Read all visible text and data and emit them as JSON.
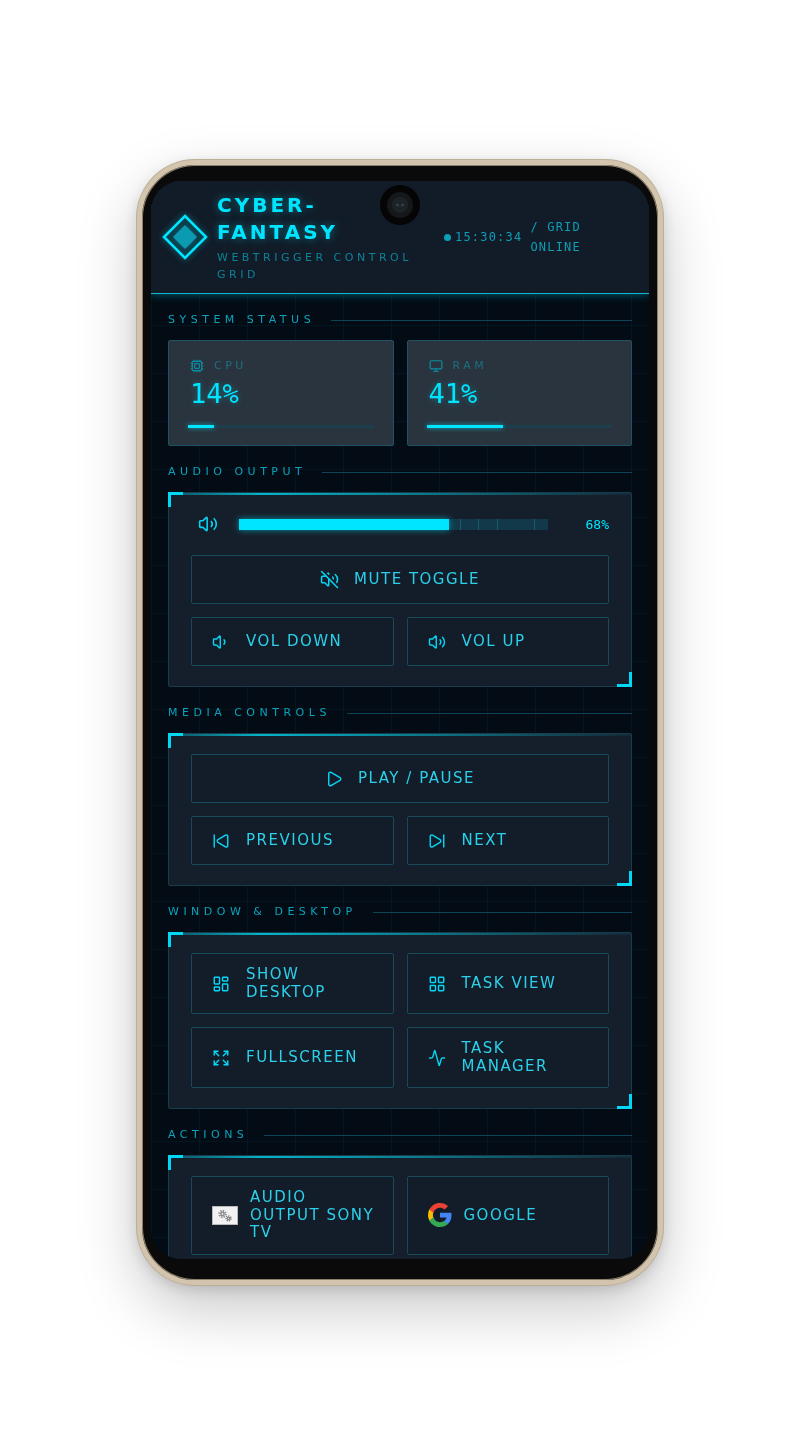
{
  "header": {
    "title": "CYBER-FANTASY",
    "subtitle": "WEBTRIGGER CONTROL GRID",
    "clock": "15:30:34",
    "status": "/ GRID ONLINE"
  },
  "system_status": {
    "title": "SYSTEM STATUS",
    "meters": [
      {
        "kind": "cpu",
        "label": "CPU",
        "value": "14%",
        "level": 0.14
      },
      {
        "kind": "ram",
        "label": "RAM",
        "value": "41%",
        "level": 0.41
      }
    ]
  },
  "panels": [
    {
      "title": "AUDIO OUTPUT",
      "volume": {
        "level": 0.68,
        "reading": "68%"
      },
      "rows": [
        {
          "buttons": [
            {
              "kind": "mute",
              "label": "MUTE TOGGLE"
            }
          ]
        },
        {
          "buttons": [
            {
              "kind": "voldown",
              "label": "VOL DOWN"
            },
            {
              "kind": "volup",
              "label": "VOL UP"
            }
          ]
        }
      ]
    },
    {
      "title": "MEDIA CONTROLS",
      "rows": [
        {
          "buttons": [
            {
              "kind": "play",
              "label": "PLAY / PAUSE"
            }
          ]
        },
        {
          "buttons": [
            {
              "kind": "previous",
              "label": "PREVIOUS"
            },
            {
              "kind": "next",
              "label": "NEXT"
            }
          ]
        }
      ]
    },
    {
      "title": "WINDOW & DESKTOP",
      "rows": [
        {
          "buttons": [
            {
              "kind": "desktop",
              "label": "SHOW DESKTOP"
            },
            {
              "kind": "taskview",
              "label": "TASK VIEW"
            }
          ]
        },
        {
          "buttons": [
            {
              "kind": "fullscreen",
              "label": "FULLSCREEN"
            },
            {
              "kind": "taskmanager",
              "label": "TASK MANAGER"
            }
          ]
        }
      ]
    },
    {
      "title": "ACTIONS",
      "rows": [
        {
          "buttons": [
            {
              "kind": "app",
              "label": "AUDIO OUTPUT SONY TV"
            },
            {
              "kind": "google",
              "label": "GOOGLE"
            }
          ]
        }
      ]
    }
  ]
}
